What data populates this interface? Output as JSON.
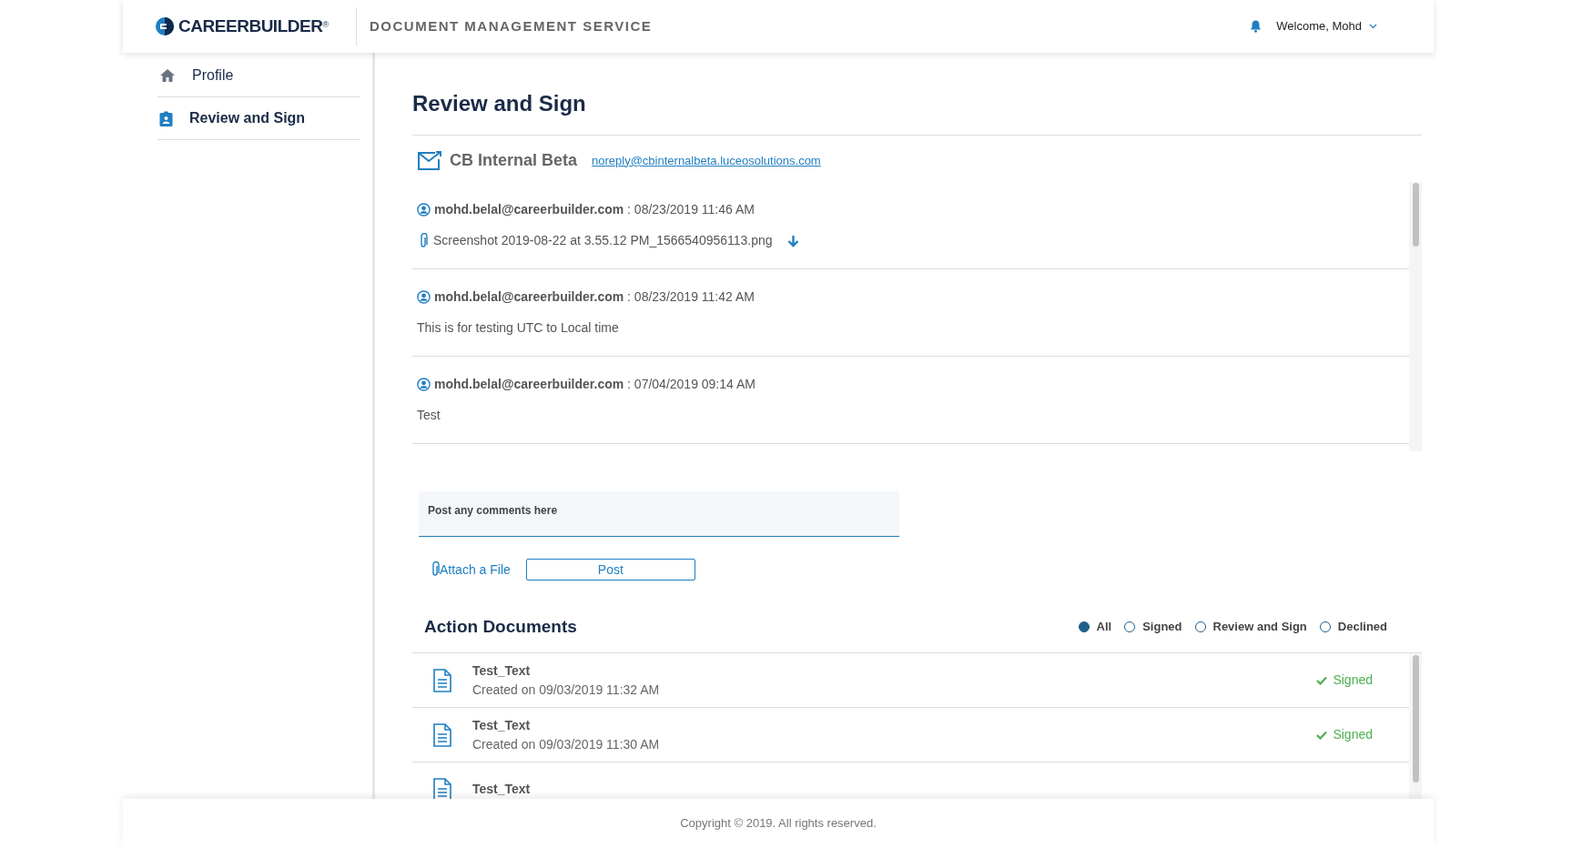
{
  "header": {
    "logo_text": "CAREERBUILDER",
    "logo_mark": "®",
    "service_title": "DOCUMENT MANAGEMENT SERVICE",
    "welcome": "Welcome, Mohd"
  },
  "sidebar": {
    "items": [
      {
        "label": "Profile",
        "kind": "home",
        "selected": false
      },
      {
        "label": "Review and Sign",
        "kind": "clipboard",
        "selected": true
      }
    ]
  },
  "page_title": "Review and Sign",
  "sender": {
    "name": "CB Internal Beta",
    "email": "noreply@cbinternalbeta.luceosolutions.com"
  },
  "messages": [
    {
      "author": "mohd.belal@careerbuilder.com",
      "separator": ":",
      "time": "08/23/2019 11:46 AM",
      "kind": "attachment",
      "body": "Screenshot 2019-08-22 at 3.55.12 PM_1566540956113.png"
    },
    {
      "author": "mohd.belal@careerbuilder.com",
      "separator": ":",
      "time": "08/23/2019 11:42 AM",
      "kind": "text",
      "body": "This is for testing UTC to Local time"
    },
    {
      "author": "mohd.belal@careerbuilder.com",
      "separator": ":",
      "time": "07/04/2019 09:14 AM",
      "kind": "text",
      "body": "Test"
    }
  ],
  "comment": {
    "placeholder": "Post any comments here",
    "attach_label": "Attach a File",
    "post_label": "Post"
  },
  "action_documents": {
    "title": "Action Documents",
    "filters": [
      {
        "label": "All",
        "selected": true
      },
      {
        "label": "Signed",
        "selected": false
      },
      {
        "label": "Review and Sign",
        "selected": false
      },
      {
        "label": "Declined",
        "selected": false
      }
    ],
    "documents": [
      {
        "name": "Test_Text",
        "created": "Created on 09/03/2019 11:32 AM",
        "status": "Signed"
      },
      {
        "name": "Test_Text",
        "created": "Created on 09/03/2019 11:30 AM",
        "status": "Signed"
      },
      {
        "name": "Test_Text"
      }
    ]
  },
  "footer": "Copyright © 2019. All rights reserved."
}
